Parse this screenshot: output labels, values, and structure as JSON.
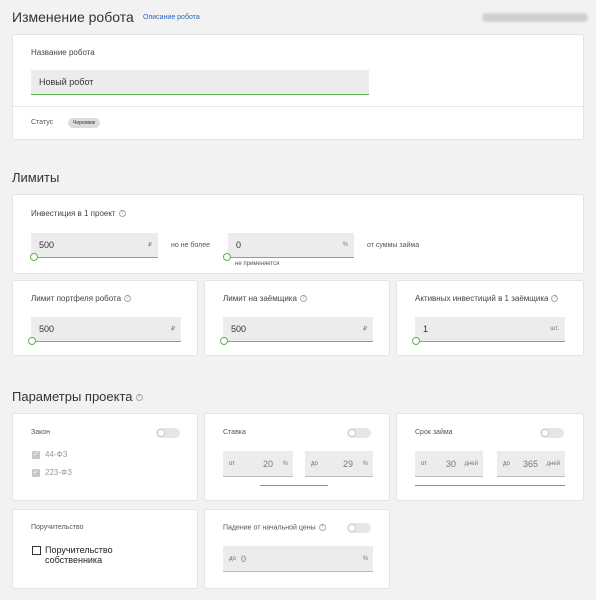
{
  "header": {
    "title": "Изменение робота",
    "link": "Описание робота"
  },
  "name_card": {
    "label": "Название робота",
    "value": "Новый робот",
    "status_label": "Статус",
    "status_badge": "Черновик"
  },
  "limits": {
    "title": "Лимиты",
    "investment": {
      "label": "Инвестиция в 1 проект",
      "value": "500",
      "unit": "₽",
      "connector": "но не более",
      "percent_value": "0",
      "percent_unit": "%",
      "suffix": "от суммы займа",
      "hint": "не применяется"
    },
    "portfolio": {
      "label": "Лимит портфеля робота",
      "value": "500",
      "unit": "₽"
    },
    "borrower": {
      "label": "Лимит на заёмщика",
      "value": "500",
      "unit": "₽"
    },
    "active": {
      "label": "Активных инвестиций в 1 заёмщика",
      "value": "1",
      "unit": "шт."
    }
  },
  "params": {
    "title": "Параметры проекта",
    "law": {
      "label": "Закон",
      "options": [
        {
          "label": "44-ФЗ",
          "checked": true
        },
        {
          "label": "223-ФЗ",
          "checked": true
        }
      ]
    },
    "rate": {
      "label": "Ставка",
      "from_prefix": "от",
      "from_value": "20",
      "from_unit": "%",
      "to_prefix": "до",
      "to_value": "29",
      "to_unit": "%"
    },
    "term": {
      "label": "Срок займа",
      "from_prefix": "от",
      "from_value": "30",
      "from_unit": "дней",
      "to_prefix": "до",
      "to_value": "365",
      "to_unit": "дней"
    },
    "guarantee": {
      "label": "Поручительство",
      "option": "Поручительство собственника",
      "checked": false
    },
    "drop": {
      "label": "Падение от начальной цены",
      "prefix": "до",
      "value": "0",
      "unit": "%"
    }
  },
  "colors": {
    "accent": "#5cb24a",
    "link": "#2a66b8",
    "background": "#f2f2f2"
  }
}
